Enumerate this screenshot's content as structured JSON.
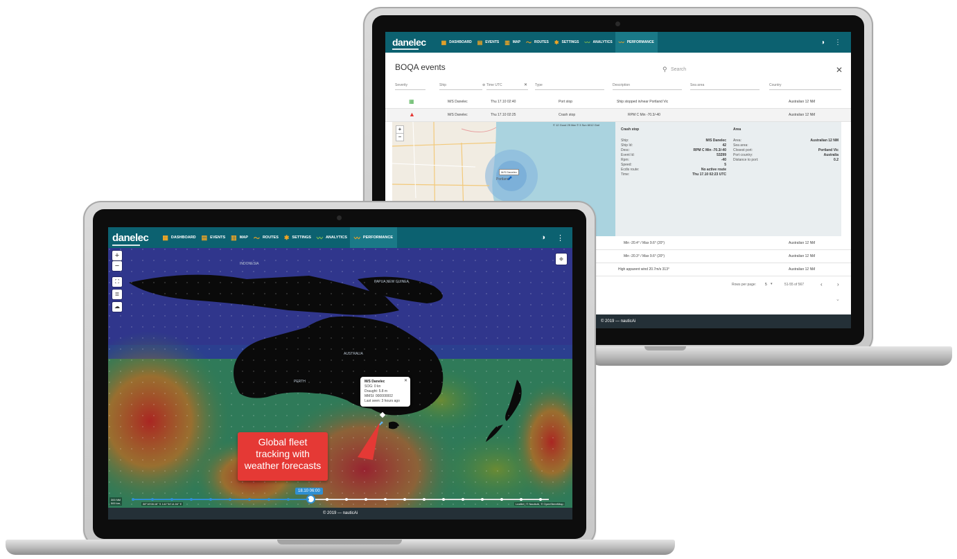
{
  "brand": {
    "logo": "danelec",
    "sub": "MARINE"
  },
  "nav": [
    {
      "label": "DASHBOARD",
      "icon": "dashboard-icon"
    },
    {
      "label": "EVENTS",
      "icon": "calendar-icon"
    },
    {
      "label": "MAP",
      "icon": "map-icon"
    },
    {
      "label": "ROUTES",
      "icon": "routes-icon"
    },
    {
      "label": "SETTINGS",
      "icon": "gear-icon"
    },
    {
      "label": "ANALYTICS",
      "icon": "analytics-icon"
    },
    {
      "label": "PERFORMANCE",
      "icon": "performance-icon",
      "active": true
    }
  ],
  "header_icons": [
    "contrast-icon",
    "more-vert-icon"
  ],
  "footer": "© 2019 — nauticAi",
  "boqa": {
    "title": "BOQA events",
    "search_placeholder": "Search",
    "columns": [
      "Severity",
      "Ship",
      "Time UTC",
      "Type",
      "Description",
      "Sea area",
      "Country"
    ],
    "rows": [
      {
        "severity": "info",
        "ship": "M/S Danelec",
        "time": "Thu 17.10 02:40",
        "type": "Port stop",
        "description": "Ship stopped in/near Portland Vic",
        "country": "Australian 12 NM"
      },
      {
        "severity": "warning",
        "ship": "M/S Danelec",
        "time": "Thu 17.10 02:25",
        "type": "Crash stop",
        "description": "RPM C Min -70.3/-40",
        "country": "Australian 12 NM"
      }
    ],
    "detail": {
      "map_place": "Portland",
      "map_ship": "M/S Danelec",
      "map_scale_note": "© 12 Good 25 Mar © 3 Sun 6012 Gnrl",
      "event_title": "Crash stop",
      "event_fields": [
        {
          "k": "Ship:",
          "v": "M/S Danelec"
        },
        {
          "k": "Ship Id:",
          "v": "42"
        },
        {
          "k": "Desc:",
          "v": "RPM C Min -70.3/-40"
        },
        {
          "k": "Event Id:",
          "v": "53299"
        },
        {
          "k": "Rpm:",
          "v": "-40"
        },
        {
          "k": "Speed:",
          "v": "5"
        },
        {
          "k": "Ecdis route:",
          "v": "No active route"
        },
        {
          "k": "Time:",
          "v": "Thu 17.10 02:23 UTC"
        }
      ],
      "area_title": "Area",
      "area_fields": [
        {
          "k": "Area:",
          "v": "Australian 12 NM"
        },
        {
          "k": "Sea area:",
          "v": ""
        },
        {
          "k": "Closest port:",
          "v": "Portland Vic"
        },
        {
          "k": "Port country:",
          "v": "Australia"
        },
        {
          "k": "Distance to port:",
          "v": "0.2"
        }
      ]
    },
    "more_rows": [
      {
        "description": "Min -20.4° / Max 9.6° (20°)",
        "country": "Australian 12 NM"
      },
      {
        "description": "Min -20.3° / Max 9.6° (20°)",
        "country": "Australian 12 NM"
      },
      {
        "description": "High apparent wind 20.7m/s 313°",
        "country": "Australian 12 NM"
      }
    ],
    "pager": {
      "rows_label": "Rows per page:",
      "rows_value": "5",
      "range": "51-55 of 567"
    }
  },
  "map": {
    "popup": {
      "title": "M/S Danelec",
      "lines": [
        "SOG: 0 kn",
        "Draught: 5.8 m",
        "MMSI: 000000002",
        "Last seen: 3 hours ago"
      ]
    },
    "callout": [
      "Global fleet",
      "tracking with",
      "weather forecasts"
    ],
    "timeline_label": "18.10 06:00",
    "scale": [
      "300 NM",
      "500 km"
    ],
    "coords": "38°16'08.16\" S 141°34'14.04\" E",
    "attribution": "Leaflet | © NauticAi, © OpenStreetMap",
    "place_labels": [
      "AUSTRALIA",
      "PERTH",
      "PAPUA NEW GUINEA",
      "INDONESIA"
    ],
    "controls": [
      "zoom-in",
      "zoom-out",
      "fullscreen",
      "layers",
      "weather"
    ]
  },
  "colors": {
    "header": "#0c6170",
    "active_tab": "#1a7987",
    "footer": "#243037",
    "callout": "#e53935",
    "timeline": "#2f8fd1"
  }
}
